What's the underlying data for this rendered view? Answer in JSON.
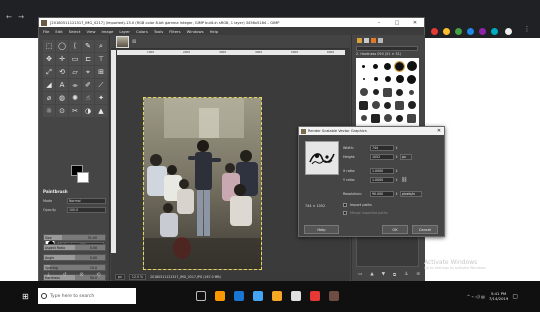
{
  "chrome": {
    "back_glyph": "←",
    "forward_glyph": "→",
    "menu_glyph": "⋮"
  },
  "window": {
    "title": "[20180511121317_IMG_0217] (imported)-13.0 (RGB color 8-bit gamma integer, GIMP built-in sRGB, 1 layer) 3456x5184 – GIMP",
    "min": "–",
    "max": "□",
    "close": "✕"
  },
  "menu": [
    "File",
    "Edit",
    "Select",
    "View",
    "Image",
    "Layer",
    "Colors",
    "Tools",
    "Filters",
    "Windows",
    "Help"
  ],
  "toolbox": {
    "tools": [
      "⬚",
      "◯",
      "ᛕ",
      "✎",
      "⌕",
      "✥",
      "✛",
      "▭",
      "⊏",
      "⊤",
      "⤢",
      "⟲",
      "▱",
      "⌖",
      "⊞",
      "◢",
      "A",
      "⌯",
      "✐",
      "⟋",
      "⌀",
      "◍",
      "✺",
      "☝",
      "✦",
      "☼",
      "⊙",
      "✂",
      "◑",
      "▲"
    ],
    "brush_tool_title": "Paintbrush",
    "mode_label": "Mode",
    "mode_value": "Normal",
    "opacity_label": "Opacity",
    "opacity_value": "100.0",
    "brush_label": "Brush",
    "brush_name": "2. Hardness 050",
    "sliders": [
      {
        "label": "Size",
        "value": "51.00",
        "fraction": 0.3
      },
      {
        "label": "Aspect Ratio",
        "value": "0.00",
        "fraction": 0.5
      },
      {
        "label": "Angle",
        "value": "0.00",
        "fraction": 0.5
      },
      {
        "label": "Spacing",
        "value": "10.0",
        "fraction": 0.1
      },
      {
        "label": "Hardness",
        "value": "50.0",
        "fraction": 0.5
      }
    ]
  },
  "canvas": {
    "ruler_ticks": [
      "1000",
      "2000",
      "3000",
      "4000",
      "5000",
      "6000"
    ],
    "status_unit": "px",
    "status_zoom": "12.5 %",
    "status_text": "20180511121317_IMG_0217.JPG (167.0 MB)"
  },
  "dock": {
    "brush_name": "2. Hardness 050 (51 × 51)"
  },
  "dialog": {
    "title": "Render Scalable Vector Graphics",
    "preview_size": "744 × 1052",
    "width_label": "Width:",
    "width_value": "744",
    "height_label": "Height:",
    "height_value": "1052",
    "unit": "px",
    "xratio_label": "X ratio:",
    "xratio_value": "1.0000",
    "yratio_label": "Y ratio:",
    "yratio_value": "1.0000",
    "resolution_label": "Resolution:",
    "resolution_value": "90.000",
    "resolution_unit": "pixels/in",
    "import_paths_label": "Import paths",
    "merge_paths_label": "Merge imported paths",
    "help_label": "Help",
    "ok_label": "OK",
    "cancel_label": "Cancel"
  },
  "activation": {
    "title": "Activate Windows",
    "subtitle": "Go to Settings to activate Windows."
  },
  "taskbar": {
    "search_placeholder": "Type here to search",
    "time": "5:41 PM",
    "date": "7/14/2019",
    "tray_glyphs": "^ ⌁ ◁) ▤"
  },
  "colors": {
    "gimp_bg": "#454545",
    "taskbar": "#101010",
    "fg": "#000000",
    "bg": "#ffffff"
  }
}
